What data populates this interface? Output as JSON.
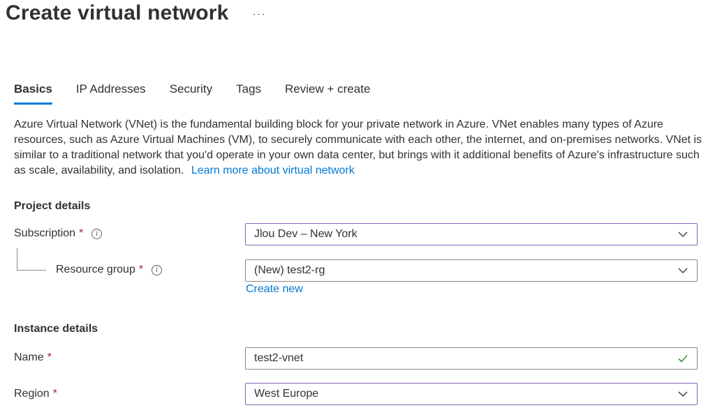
{
  "header": {
    "title": "Create virtual network",
    "more_label": "···"
  },
  "tabs": [
    {
      "label": "Basics",
      "active": true
    },
    {
      "label": "IP Addresses",
      "active": false
    },
    {
      "label": "Security",
      "active": false
    },
    {
      "label": "Tags",
      "active": false
    },
    {
      "label": "Review + create",
      "active": false
    }
  ],
  "description": {
    "text": "Azure Virtual Network (VNet) is the fundamental building block for your private network in Azure. VNet enables many types of Azure resources, such as Azure Virtual Machines (VM), to securely communicate with each other, the internet, and on-premises networks. VNet is similar to a traditional network that you'd operate in your own data center, but brings with it additional benefits of Azure's infrastructure such as scale, availability, and isolation.",
    "link_text": "Learn more about virtual network"
  },
  "project_details": {
    "heading": "Project details",
    "subscription": {
      "label": "Subscription",
      "required_mark": "*",
      "value": "Jlou Dev – New York"
    },
    "resource_group": {
      "label": "Resource group",
      "required_mark": "*",
      "value": "(New) test2-rg",
      "create_new_label": "Create new"
    }
  },
  "instance_details": {
    "heading": "Instance details",
    "name": {
      "label": "Name",
      "required_mark": "*",
      "value": "test2-vnet"
    },
    "region": {
      "label": "Region",
      "required_mark": "*",
      "value": "West Europe"
    }
  },
  "colors": {
    "accent": "#0078d4",
    "focus_border": "#8764b8",
    "required": "#a4262c",
    "valid_check": "#107c10"
  },
  "icons": {
    "info": "info-icon",
    "dropdown": "chevron-down-icon",
    "valid": "checkmark-icon",
    "more": "more-icon"
  }
}
